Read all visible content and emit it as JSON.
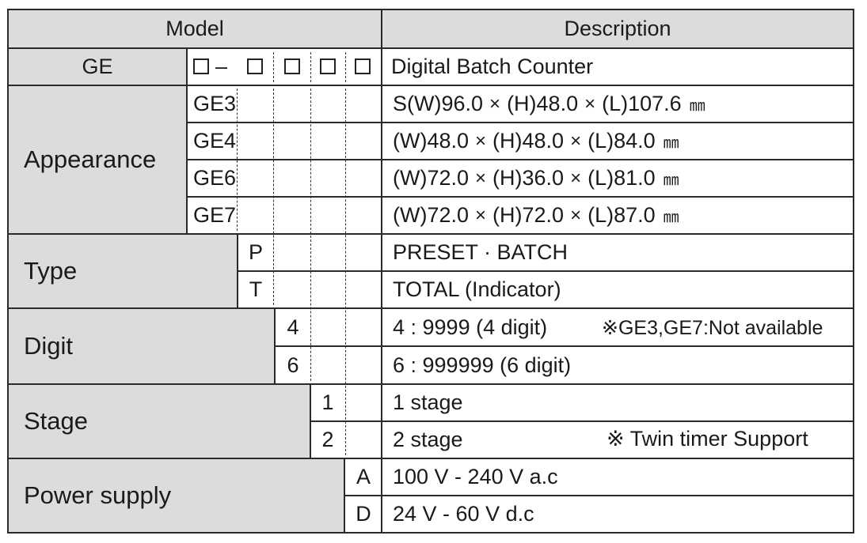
{
  "header": {
    "model": "Model",
    "description": "Description"
  },
  "ge_row": {
    "code": "GE",
    "separator": "–",
    "description": "Digital Batch Counter"
  },
  "appearance": {
    "label": "Appearance",
    "rows": [
      {
        "code": "GE3",
        "prefix": "S",
        "w": "(W)96.0",
        "h": "(H)48.0",
        "l": "(L)107.6",
        "unit": "㎜"
      },
      {
        "code": "GE4",
        "prefix": "",
        "w": "(W)48.0",
        "h": "(H)48.0",
        "l": "(L)84.0",
        "unit": "㎜"
      },
      {
        "code": "GE6",
        "prefix": "",
        "w": "(W)72.0",
        "h": "(H)36.0",
        "l": "(L)81.0",
        "unit": "㎜"
      },
      {
        "code": "GE7",
        "prefix": "",
        "w": "(W)72.0",
        "h": "(H)72.0",
        "l": "(L)87.0",
        "unit": "㎜"
      }
    ],
    "times": "×"
  },
  "type": {
    "label": "Type",
    "rows": [
      {
        "code": "P",
        "description": "PRESET · BATCH"
      },
      {
        "code": "T",
        "description": "TOTAL (Indicator)"
      }
    ]
  },
  "digit": {
    "label": "Digit",
    "rows": [
      {
        "code": "4",
        "description": "4 : 9999 (4 digit)",
        "note": "※GE3,GE7:Not available"
      },
      {
        "code": "6",
        "description": "6 : 999999 (6 digit)",
        "note": ""
      }
    ]
  },
  "stage": {
    "label": "Stage",
    "rows": [
      {
        "code": "1",
        "description": "1 stage",
        "note": ""
      },
      {
        "code": "2",
        "description": "2 stage",
        "note": "※ Twin timer Support"
      }
    ]
  },
  "power": {
    "label": "Power supply",
    "rows": [
      {
        "code": "A",
        "description": "100 V - 240 V a.c"
      },
      {
        "code": "D",
        "description": "24 V - 60 V d.c"
      }
    ]
  }
}
